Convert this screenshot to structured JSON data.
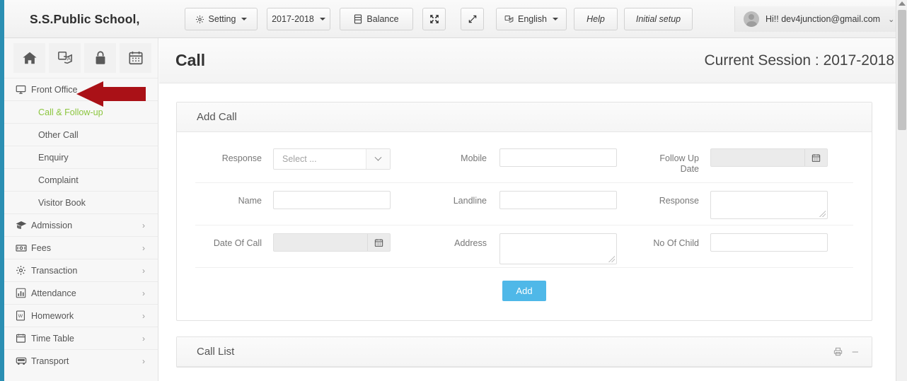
{
  "colors": {
    "accent_strip": "#2b8fb3",
    "active_nav": "#8cc63f",
    "add_button": "#4fb8e8",
    "annotation_arrow": "#aa1117"
  },
  "topbar": {
    "brand": "S.S.Public School,",
    "buttons": [
      {
        "id": "setting",
        "label": "Setting",
        "icon": "gear-icon",
        "caret": true
      },
      {
        "id": "session",
        "label": "2017-2018",
        "icon": null,
        "caret": true
      },
      {
        "id": "balance",
        "label": "Balance",
        "icon": "database-icon",
        "caret": false
      },
      {
        "id": "arrows",
        "label": "",
        "icon": "arrows-alt-icon",
        "caret": false
      },
      {
        "id": "expand",
        "label": "",
        "icon": "expand-icon",
        "caret": false
      },
      {
        "id": "language",
        "label": "English",
        "icon": "translate-icon",
        "caret": true
      },
      {
        "id": "help",
        "label": "Help",
        "icon": null,
        "caret": false
      },
      {
        "id": "initialsetup",
        "label": "Initial setup",
        "icon": null,
        "caret": false
      }
    ],
    "user": {
      "greeting": "Hi!! dev4junction@gmail.com",
      "chevron": "⌄"
    }
  },
  "sidebar": {
    "quick_icons": [
      {
        "name": "home-icon"
      },
      {
        "name": "translate-icon"
      },
      {
        "name": "lock-icon"
      },
      {
        "name": "calendar-icon"
      }
    ],
    "items": [
      {
        "label": "Front Office",
        "icon": "monitor-icon",
        "arrow": "⌄",
        "expanded": true
      },
      {
        "label": "Admission",
        "icon": "graduation-icon",
        "arrow": "›",
        "expanded": false
      },
      {
        "label": "Fees",
        "icon": "money-icon",
        "arrow": "›",
        "expanded": false
      },
      {
        "label": "Transaction",
        "icon": "gear-icon",
        "arrow": "›",
        "expanded": false
      },
      {
        "label": "Attendance",
        "icon": "barchart-icon",
        "arrow": "›",
        "expanded": false
      },
      {
        "label": "Homework",
        "icon": "document-icon",
        "arrow": "›",
        "expanded": false
      },
      {
        "label": "Time Table",
        "icon": "calendar-icon",
        "arrow": "›",
        "expanded": false
      },
      {
        "label": "Transport",
        "icon": "bus-icon",
        "arrow": "›",
        "expanded": false
      }
    ],
    "submenu": [
      {
        "label": "Call & Follow-up",
        "active": true
      },
      {
        "label": "Other Call",
        "active": false
      },
      {
        "label": "Enquiry",
        "active": false
      },
      {
        "label": "Complaint",
        "active": false
      },
      {
        "label": "Visitor Book",
        "active": false
      }
    ]
  },
  "page": {
    "title": "Call",
    "session_text": "Current Session : 2017-2018"
  },
  "add_call": {
    "panel_title": "Add Call",
    "fields": {
      "response_select_label": "Response",
      "response_select_value": "Select ...",
      "mobile_label": "Mobile",
      "mobile_value": "",
      "followup_label_line1": "Follow Up",
      "followup_label_line2": "Date",
      "followup_value": "",
      "name_label": "Name",
      "name_value": "",
      "landline_label": "Landline",
      "landline_value": "",
      "response_text_label": "Response",
      "response_text_value": "",
      "dateofcall_label": "Date Of Call",
      "dateofcall_value": "",
      "address_label": "Address",
      "address_value": "",
      "nochild_label": "No Of Child",
      "nochild_value": ""
    },
    "submit_label": "Add"
  },
  "call_list": {
    "panel_title": "Call List",
    "tools": [
      {
        "name": "print-icon",
        "glyph": "⎙"
      },
      {
        "name": "minimize-icon",
        "glyph": "–"
      }
    ]
  }
}
